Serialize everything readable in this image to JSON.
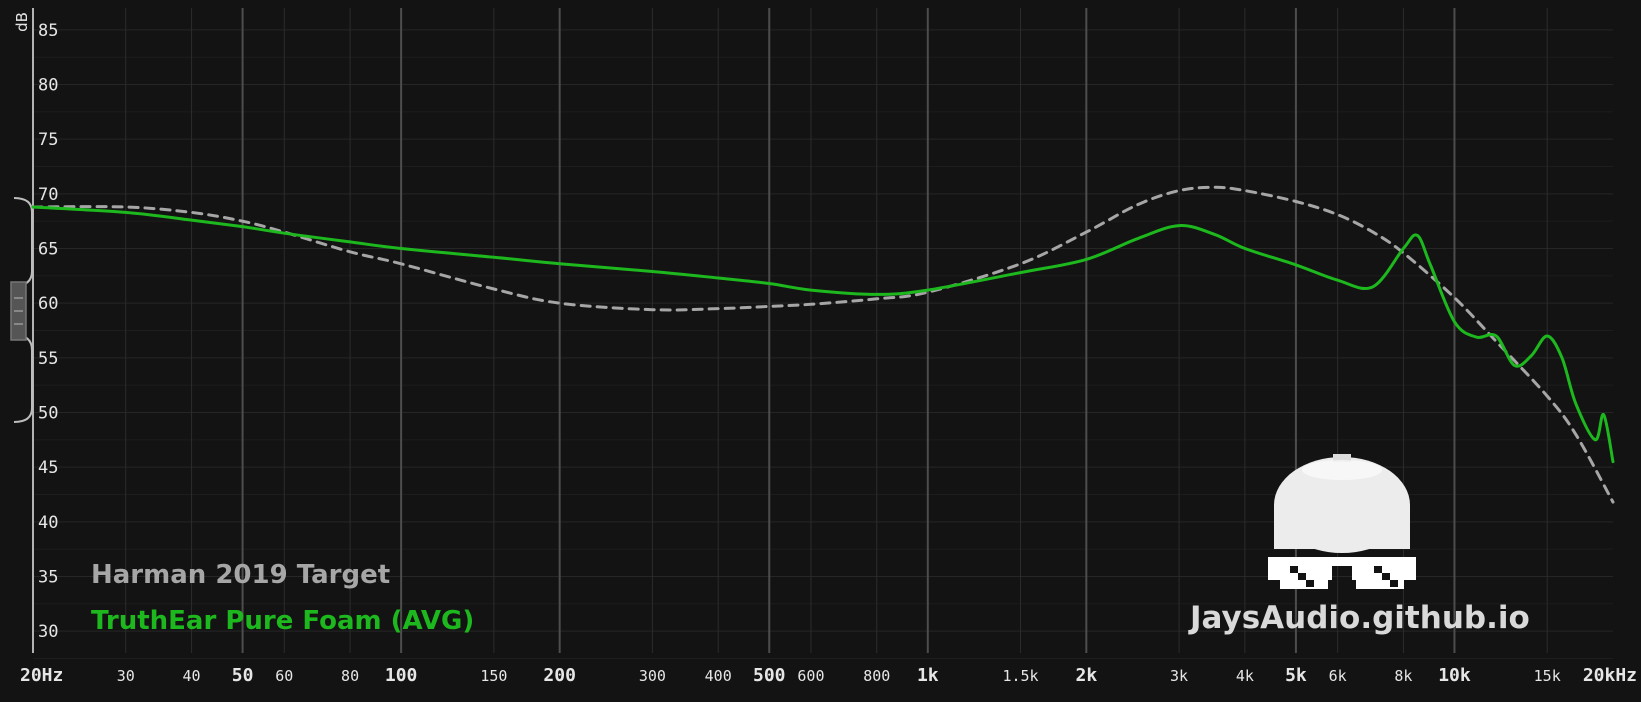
{
  "chart_data": {
    "type": "line",
    "xscale": "log",
    "xlim": [
      20,
      20000
    ],
    "ylim": [
      28,
      87
    ],
    "ylabel": "dB",
    "grid": true,
    "y_ticks": [
      30,
      35,
      40,
      45,
      50,
      55,
      60,
      65,
      70,
      75,
      80,
      85
    ],
    "x_ticks": [
      {
        "value": 20,
        "label": "20Hz",
        "major": true
      },
      {
        "value": 30,
        "label": "30",
        "major": false
      },
      {
        "value": 40,
        "label": "40",
        "major": false
      },
      {
        "value": 50,
        "label": "50",
        "major": true
      },
      {
        "value": 60,
        "label": "60",
        "major": false
      },
      {
        "value": 80,
        "label": "80",
        "major": false
      },
      {
        "value": 100,
        "label": "100",
        "major": true
      },
      {
        "value": 150,
        "label": "150",
        "major": false
      },
      {
        "value": 200,
        "label": "200",
        "major": true
      },
      {
        "value": 300,
        "label": "300",
        "major": false
      },
      {
        "value": 400,
        "label": "400",
        "major": false
      },
      {
        "value": 500,
        "label": "500",
        "major": true
      },
      {
        "value": 600,
        "label": "600",
        "major": false
      },
      {
        "value": 800,
        "label": "800",
        "major": false
      },
      {
        "value": 1000,
        "label": "1k",
        "major": true
      },
      {
        "value": 1500,
        "label": "1.5k",
        "major": false
      },
      {
        "value": 2000,
        "label": "2k",
        "major": true
      },
      {
        "value": 3000,
        "label": "3k",
        "major": false
      },
      {
        "value": 4000,
        "label": "4k",
        "major": false
      },
      {
        "value": 5000,
        "label": "5k",
        "major": true
      },
      {
        "value": 6000,
        "label": "6k",
        "major": false
      },
      {
        "value": 8000,
        "label": "8k",
        "major": false
      },
      {
        "value": 10000,
        "label": "10k",
        "major": true
      },
      {
        "value": 15000,
        "label": "15k",
        "major": false
      },
      {
        "value": 20000,
        "label": "20kHz",
        "major": true
      }
    ],
    "series": [
      {
        "name": "Harman 2019 Target",
        "color": "#a6a6a6",
        "dashed": true,
        "points": [
          [
            20,
            68.8
          ],
          [
            30,
            68.8
          ],
          [
            40,
            68.3
          ],
          [
            50,
            67.5
          ],
          [
            60,
            66.5
          ],
          [
            80,
            64.7
          ],
          [
            100,
            63.6
          ],
          [
            150,
            61.3
          ],
          [
            200,
            60.0
          ],
          [
            300,
            59.4
          ],
          [
            400,
            59.5
          ],
          [
            500,
            59.7
          ],
          [
            600,
            59.9
          ],
          [
            800,
            60.4
          ],
          [
            1000,
            61.0
          ],
          [
            1500,
            63.6
          ],
          [
            2000,
            66.5
          ],
          [
            2500,
            69.0
          ],
          [
            3000,
            70.3
          ],
          [
            3500,
            70.6
          ],
          [
            4000,
            70.3
          ],
          [
            5000,
            69.3
          ],
          [
            6000,
            68.1
          ],
          [
            7000,
            66.5
          ],
          [
            8000,
            64.6
          ],
          [
            10000,
            60.5
          ],
          [
            12000,
            56.5
          ],
          [
            15000,
            51.5
          ],
          [
            17000,
            48.0
          ],
          [
            20000,
            41.8
          ]
        ]
      },
      {
        "name": "TruthEar Pure Foam (AVG)",
        "color": "#1db81d",
        "dashed": false,
        "points": [
          [
            20,
            68.8
          ],
          [
            30,
            68.3
          ],
          [
            40,
            67.6
          ],
          [
            50,
            67.0
          ],
          [
            60,
            66.4
          ],
          [
            80,
            65.6
          ],
          [
            100,
            65.0
          ],
          [
            150,
            64.2
          ],
          [
            200,
            63.6
          ],
          [
            300,
            62.9
          ],
          [
            400,
            62.3
          ],
          [
            500,
            61.8
          ],
          [
            600,
            61.2
          ],
          [
            800,
            60.8
          ],
          [
            1000,
            61.2
          ],
          [
            1500,
            62.8
          ],
          [
            2000,
            64.0
          ],
          [
            2500,
            65.9
          ],
          [
            3000,
            67.1
          ],
          [
            3500,
            66.3
          ],
          [
            4000,
            65.0
          ],
          [
            5000,
            63.5
          ],
          [
            6000,
            62.1
          ],
          [
            7000,
            61.5
          ],
          [
            8000,
            65.0
          ],
          [
            8500,
            66.2
          ],
          [
            9000,
            63.5
          ],
          [
            10000,
            58.3
          ],
          [
            11000,
            56.9
          ],
          [
            12000,
            57.0
          ],
          [
            13000,
            54.3
          ],
          [
            14000,
            55.2
          ],
          [
            15000,
            57.0
          ],
          [
            16000,
            55.0
          ],
          [
            17000,
            50.8
          ],
          [
            18500,
            47.5
          ],
          [
            19200,
            49.8
          ],
          [
            20000,
            45.5
          ]
        ]
      }
    ]
  },
  "watermark": {
    "text": "JaysAudio.github.io",
    "icon": "cap-and-pixel-sunglasses-icon"
  }
}
